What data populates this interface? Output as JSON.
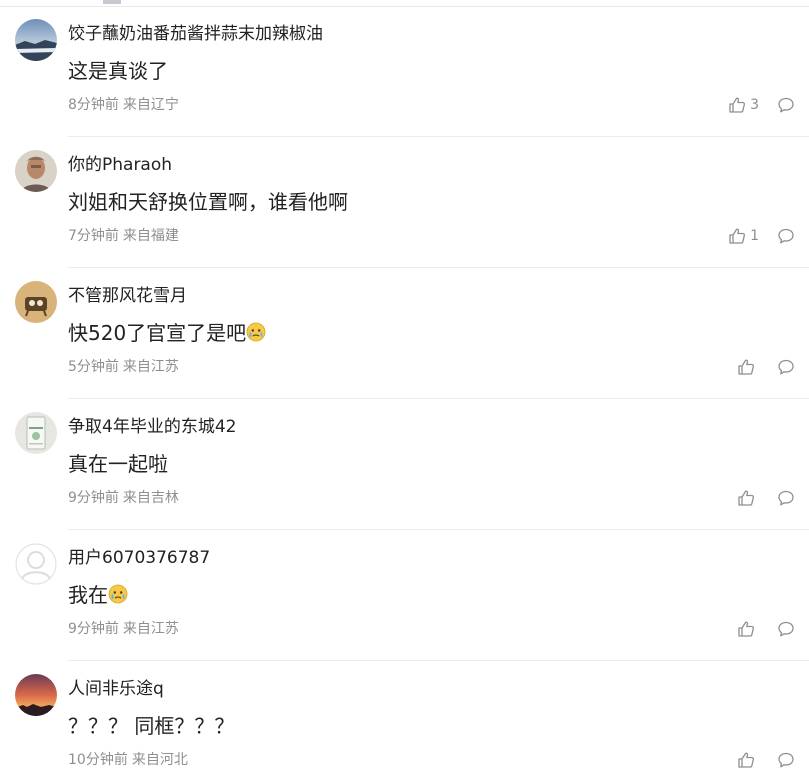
{
  "comments": [
    {
      "username": "饺子蘸奶油番茄酱拌蒜末加辣椒油",
      "text": "这是真谈了",
      "time": "8分钟前",
      "location": "来自辽宁",
      "likes": "3",
      "avatar": "landscape-avatar"
    },
    {
      "username": "你的Pharaoh",
      "text": "刘姐和天舒换位置啊，谁看他啊",
      "time": "7分钟前",
      "location": "来自福建",
      "likes": "1",
      "avatar": "person-avatar"
    },
    {
      "username": "不管那风花雪月",
      "text": "快520了官宣了是吧",
      "time": "5分钟前",
      "location": "来自江苏",
      "likes": "",
      "avatar": "cartoon-avatar",
      "emoji": "crying-emoji"
    },
    {
      "username": "争取4年毕业的东城42",
      "text": "真在一起啦",
      "time": "9分钟前",
      "location": "来自吉林",
      "likes": "",
      "avatar": "product-box-avatar"
    },
    {
      "username": "用户6070376787",
      "text": "我在",
      "time": "9分钟前",
      "location": "来自江苏",
      "likes": "",
      "avatar": "default-user-avatar",
      "emoji": "crying-emoji"
    },
    {
      "username": "人间非乐途q",
      "text": "？？？ 同框？？？",
      "time": "10分钟前",
      "location": "来自河北",
      "likes": "",
      "avatar": "sunset-avatar"
    }
  ],
  "icons": {
    "like": "thumbs-up-icon",
    "reply": "comment-bubble-icon"
  },
  "colors": {
    "text": "#222222",
    "meta": "#8f8f8f",
    "divider": "#ececec"
  }
}
